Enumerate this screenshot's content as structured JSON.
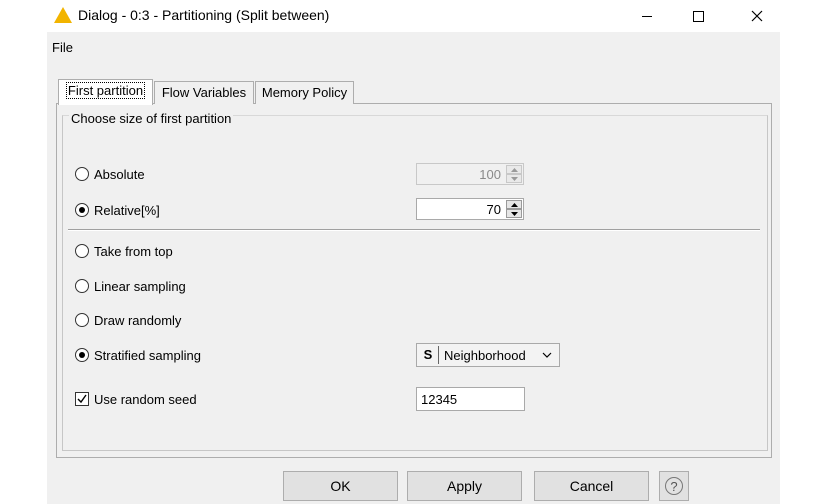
{
  "window": {
    "title": "Dialog - 0:3 - Partitioning (Split between)",
    "app_icon": "knime-warning-triangle-icon",
    "controls": [
      "minimize-icon",
      "maximize-icon",
      "close-icon"
    ]
  },
  "menu": {
    "items": [
      {
        "label": "File"
      }
    ]
  },
  "tabs": [
    {
      "label": "First partition",
      "active": true
    },
    {
      "label": "Flow Variables",
      "active": false
    },
    {
      "label": "Memory Policy",
      "active": false
    }
  ],
  "group": {
    "title": "Choose size of first partition"
  },
  "size_options": {
    "absolute": {
      "label": "Absolute",
      "selected": false,
      "value": "100",
      "enabled": false
    },
    "relative": {
      "label": "Relative[%]",
      "selected": true,
      "value": "70",
      "enabled": true
    }
  },
  "sampling_options": {
    "take_from_top": {
      "label": "Take from top",
      "selected": false
    },
    "linear": {
      "label": "Linear sampling",
      "selected": false
    },
    "random": {
      "label": "Draw randomly",
      "selected": false
    },
    "stratified": {
      "label": "Stratified sampling",
      "selected": true,
      "column_type": "S",
      "column": "Neighborhood"
    }
  },
  "seed": {
    "label": "Use random seed",
    "checked": true,
    "value": "12345"
  },
  "buttons": {
    "ok": "OK",
    "apply": "Apply",
    "cancel": "Cancel",
    "help": "?"
  },
  "colors": {
    "accent_triangle": "#f2b400",
    "dialog_bg": "#f0f0f0",
    "button_bg": "#e1e1e1"
  }
}
